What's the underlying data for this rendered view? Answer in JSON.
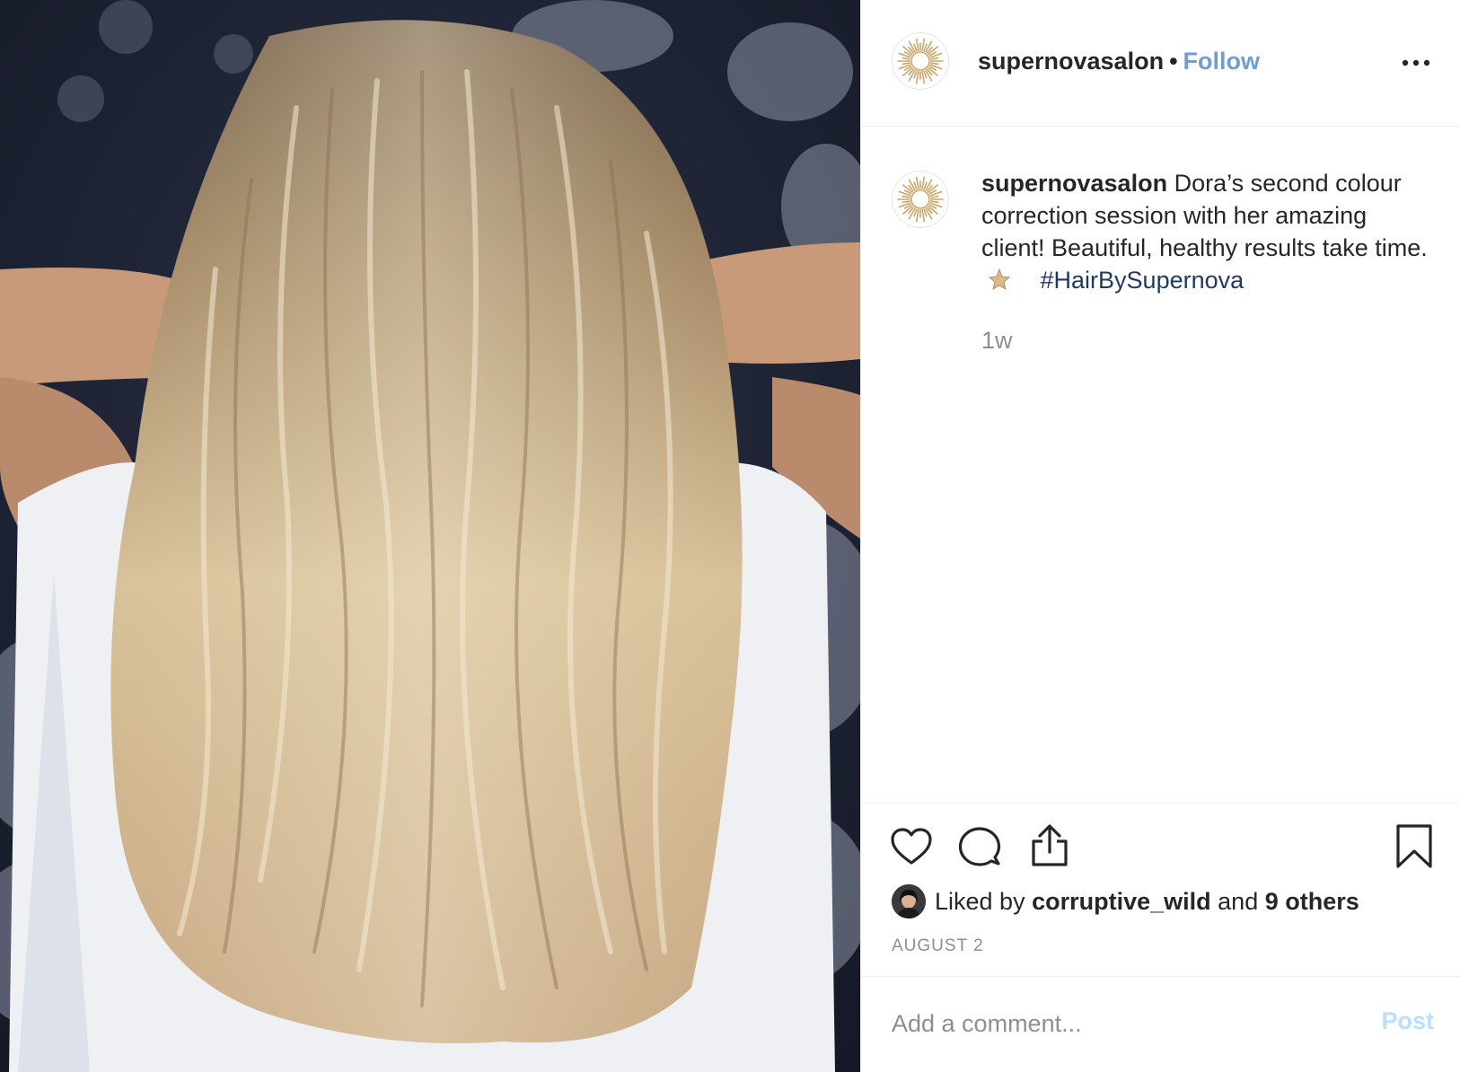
{
  "photo": {
    "description_icon": "photo-hair-back-view"
  },
  "header": {
    "username": "supernovasalon",
    "separator": "•",
    "follow_label": "Follow",
    "more_icon": "ellipsis-icon"
  },
  "caption": {
    "username": "supernovasalon",
    "text": "Dora’s second colour correction session with her amazing client! Beautiful, healthy results take time.",
    "hashtag": "#HairBySupernova",
    "time_ago": "1w"
  },
  "actions": {
    "like_icon": "heart-icon",
    "comment_icon": "comment-icon",
    "share_icon": "share-icon",
    "save_icon": "bookmark-icon"
  },
  "likes": {
    "prefix": "Liked by",
    "liker": "corruptive_wild",
    "conjunction": "and",
    "others": "9 others"
  },
  "date": "AUGUST 2",
  "comment": {
    "placeholder": "Add a comment...",
    "post_label": "Post"
  },
  "colors": {
    "follow": "#3f7ec4",
    "hashtag": "#1f3a5f",
    "post_disabled": "#b9dffc",
    "muted": "#8e8e8e",
    "logo_gold": "#c9a56a"
  }
}
